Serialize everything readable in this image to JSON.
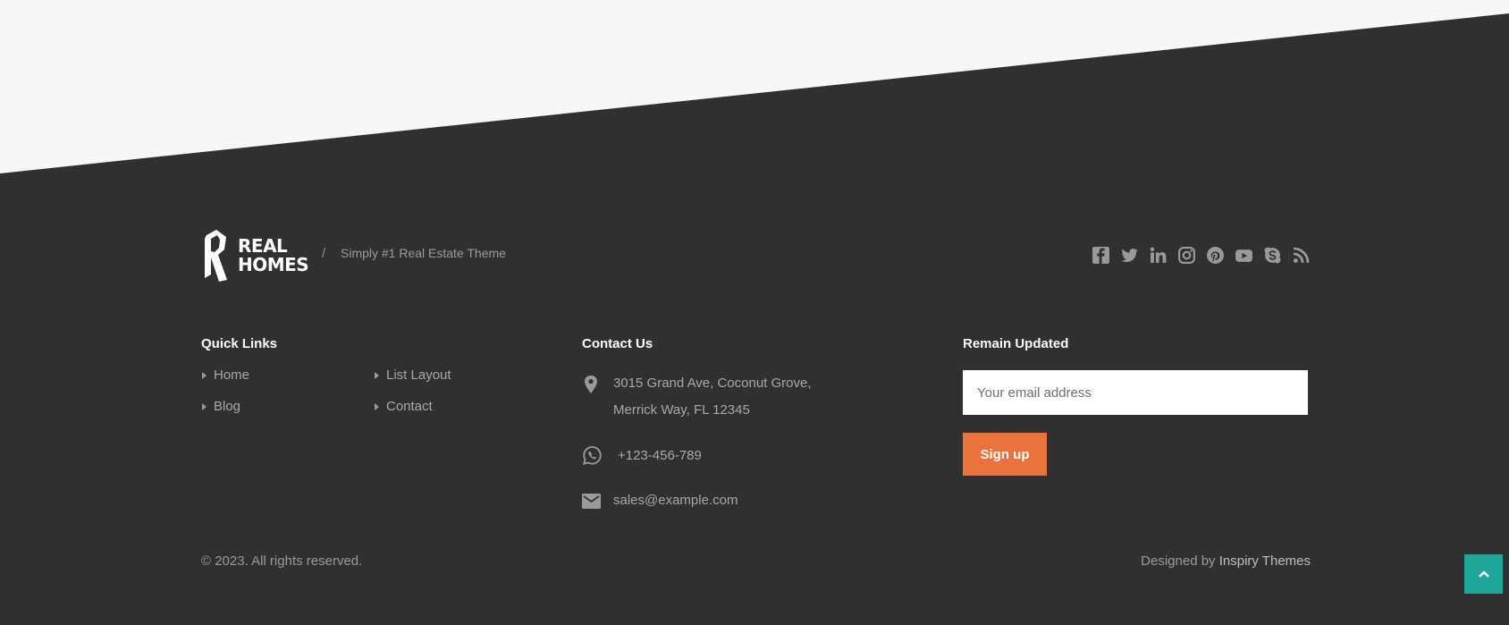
{
  "brand": {
    "logo_line1": "REAL",
    "logo_line2": "HOMES",
    "separator": "/",
    "tagline": "Simply #1 Real Estate Theme"
  },
  "social_icons": [
    "facebook-icon",
    "twitter-icon",
    "linkedin-icon",
    "instagram-icon",
    "pinterest-icon",
    "youtube-icon",
    "skype-icon",
    "rss-icon"
  ],
  "quick_links": {
    "title": "Quick Links",
    "items": [
      {
        "label": "Home"
      },
      {
        "label": "List Layout"
      },
      {
        "label": "Blog"
      },
      {
        "label": "Contact"
      }
    ]
  },
  "contact": {
    "title": "Contact Us",
    "address_line1": "3015 Grand Ave, Coconut Grove,",
    "address_line2": "Merrick Way, FL 12345",
    "phone": "+123-456-789",
    "email": "sales@example.com"
  },
  "newsletter": {
    "title": "Remain Updated",
    "placeholder": "Your email address",
    "button_label": "Sign up"
  },
  "bottom": {
    "copyright": "© 2023. All rights reserved.",
    "designed_prefix": "Designed by",
    "designer": "Inspiry Themes"
  },
  "colors": {
    "footer_bg": "#303030",
    "top_bg": "#f7f7f7",
    "accent_button": "#ea723d",
    "back_to_top": "#1ea69a"
  }
}
